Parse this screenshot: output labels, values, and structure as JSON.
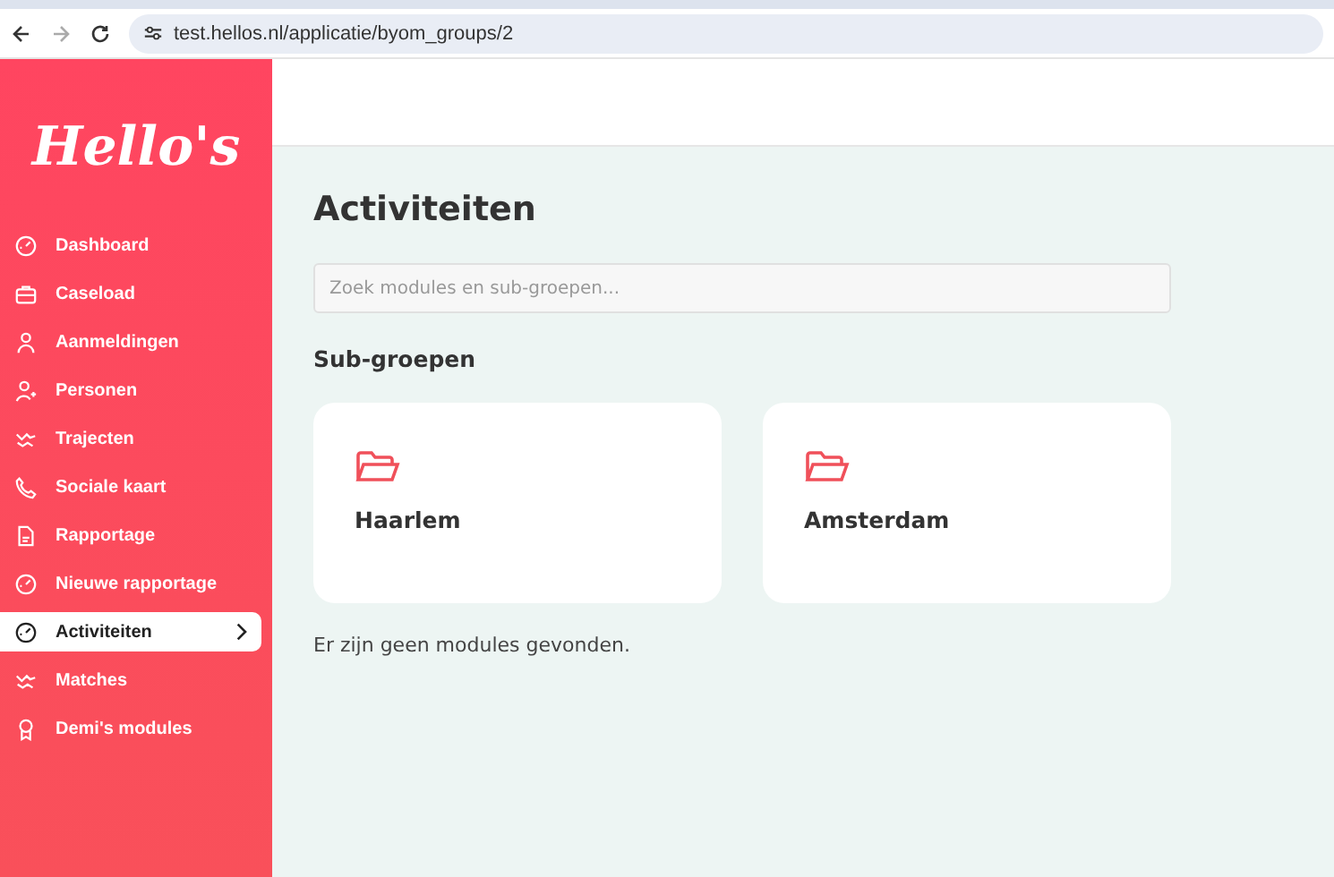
{
  "browser": {
    "url": "test.hellos.nl/applicatie/byom_groups/2"
  },
  "sidebar": {
    "logo": "Hello's",
    "items": [
      {
        "label": "Dashboard",
        "selected": false
      },
      {
        "label": "Caseload",
        "selected": false
      },
      {
        "label": "Aanmeldingen",
        "selected": false
      },
      {
        "label": "Personen",
        "selected": false
      },
      {
        "label": "Trajecten",
        "selected": false
      },
      {
        "label": "Sociale kaart",
        "selected": false
      },
      {
        "label": "Rapportage",
        "selected": false
      },
      {
        "label": "Nieuwe rapportage",
        "selected": false
      },
      {
        "label": "Activiteiten",
        "selected": true
      },
      {
        "label": "Matches",
        "selected": false
      },
      {
        "label": "Demi's modules",
        "selected": false
      }
    ]
  },
  "main": {
    "title": "Activiteiten",
    "search": {
      "placeholder": "Zoek modules en sub-groepen..."
    },
    "section_title": "Sub-groepen",
    "groups": [
      {
        "name": "Haarlem"
      },
      {
        "name": "Amsterdam"
      }
    ],
    "empty_message": "Er zijn geen modules gevonden."
  }
}
